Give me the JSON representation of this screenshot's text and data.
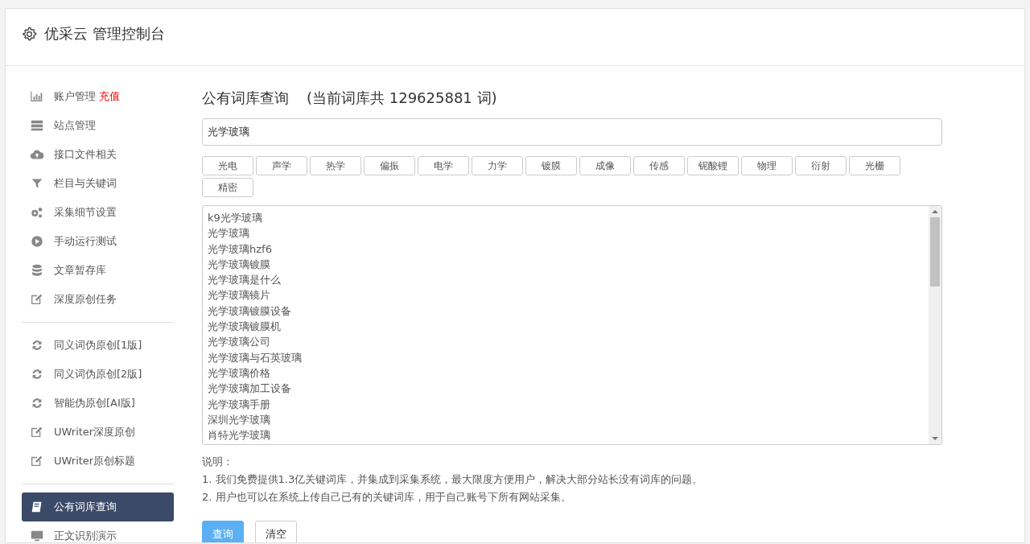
{
  "header": {
    "title": "优采云 管理控制台"
  },
  "sidebar": {
    "groups": [
      {
        "items": [
          {
            "kind": "chart",
            "label": "账户管理",
            "badge": "充值",
            "selected": false
          },
          {
            "kind": "server",
            "label": "站点管理",
            "selected": false
          },
          {
            "kind": "cloud",
            "label": "接口文件相关",
            "selected": false
          },
          {
            "kind": "filter",
            "label": "栏目与关键词",
            "selected": false
          },
          {
            "kind": "gears",
            "label": "采集细节设置",
            "selected": false
          },
          {
            "kind": "play",
            "label": "手动运行测试",
            "selected": false
          },
          {
            "kind": "database",
            "label": "文章暂存库",
            "selected": false
          },
          {
            "kind": "edit",
            "label": "深度原创任务",
            "selected": false
          }
        ]
      },
      {
        "items": [
          {
            "kind": "refresh",
            "label": "同义词伪原创[1版]",
            "selected": false
          },
          {
            "kind": "refresh",
            "label": "同义词伪原创[2版]",
            "selected": false
          },
          {
            "kind": "refresh",
            "label": "智能伪原创[AI版]",
            "selected": false
          },
          {
            "kind": "edit",
            "label": "UWriter深度原创",
            "selected": false
          },
          {
            "kind": "edit",
            "label": "UWriter原创标题",
            "selected": false
          }
        ]
      },
      {
        "items": [
          {
            "kind": "book",
            "label": "公有词库查询",
            "selected": true
          },
          {
            "kind": "monitor",
            "label": "正文识别演示",
            "selected": false
          }
        ]
      }
    ]
  },
  "main": {
    "title": "公有词库查询",
    "count_text": "(当前词库共 129625881 词)",
    "search": {
      "value": "光学玻璃"
    },
    "tags": [
      "光电",
      "声学",
      "热学",
      "偏振",
      "电学",
      "力学",
      "镀膜",
      "成像",
      "传感",
      "铌酸锂",
      "物理",
      "衍射",
      "光栅",
      "精密"
    ],
    "results": [
      "k9光学玻璃",
      "光学玻璃",
      "光学玻璃hzf6",
      "光学玻璃镀膜",
      "光学玻璃是什么",
      "光学玻璃镜片",
      "光学玻璃镀膜设备",
      "光学玻璃镀膜机",
      "光学玻璃公司",
      "光学玻璃与石英玻璃",
      "光学玻璃价格",
      "光学玻璃加工设备",
      "光学玻璃手册",
      "深圳光学玻璃",
      "肖特光学玻璃"
    ],
    "notes_title": "说明：",
    "notes": [
      "1. 我们免费提供1.3亿关键词库，并集成到采集系统，最大限度方便用户，解决大部分站长没有词库的问题。",
      "2. 用户也可以在系统上传自己已有的关键词库，用于自己账号下所有网站采集。"
    ],
    "buttons": [
      {
        "kind": "primary",
        "label": "查询"
      },
      {
        "kind": "default",
        "label": "清空"
      }
    ]
  }
}
